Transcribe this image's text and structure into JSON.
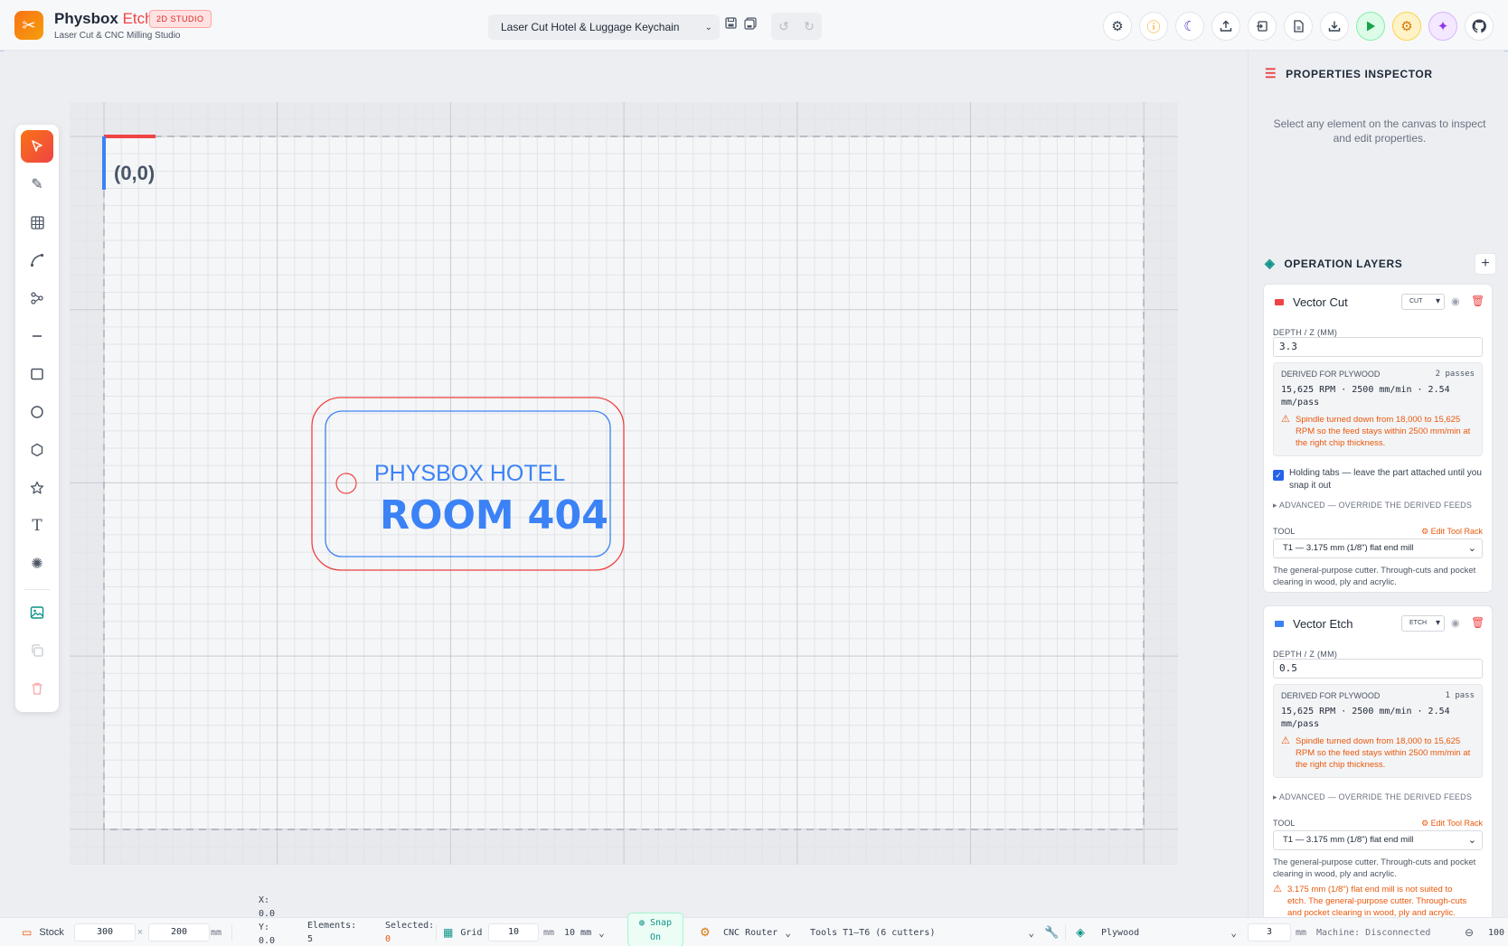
{
  "header": {
    "brand": "Physbox",
    "brand_accent": "Etch",
    "badge": "2D STUDIO",
    "subtitle": "Laser Cut & CNC Milling Studio",
    "project_name": "Laser Cut Hotel & Luggage Keychain"
  },
  "canvas": {
    "origin_label": "(0,0)",
    "keychain_line1": "PHYSBOX HOTEL",
    "keychain_line2": "ROOM 404"
  },
  "inspector": {
    "title": "PROPERTIES INSPECTOR",
    "empty_text": "Select any element on the canvas to inspect and edit properties."
  },
  "layers": {
    "title": "OPERATION LAYERS",
    "add_label": "+",
    "items": [
      {
        "name": "Vector Cut",
        "type": "CUT",
        "color": "#ef4444",
        "depth_label": "DEPTH / Z (MM)",
        "depth": "3.3",
        "derived_label": "DERIVED FOR PLYWOOD",
        "passes": "2 passes",
        "rates": "15,625 RPM · 2500 mm/min · 2.54 mm/pass",
        "warning": "Spindle turned down from 18,000 to 15,625 RPM so the feed stays within 2500 mm/min at the right chip thickness.",
        "tabs_text": "Holding tabs — leave the part attached until you snap it out",
        "advanced": "▸ ADVANCED — OVERRIDE THE DERIVED FEEDS",
        "tool_label": "TOOL",
        "edit_rack": "⚙ Edit Tool Rack",
        "tool": "T1 — 3.175 mm (1/8\") flat end mill",
        "tool_desc": "The general-purpose cutter. Through-cuts and pocket clearing in wood, ply and acrylic."
      },
      {
        "name": "Vector Etch",
        "type": "ETCH",
        "color": "#3b82f6",
        "depth_label": "DEPTH / Z (MM)",
        "depth": "0.5",
        "derived_label": "DERIVED FOR PLYWOOD",
        "passes": "1 pass",
        "rates": "15,625 RPM · 2500 mm/min · 2.54 mm/pass",
        "warning": "Spindle turned down from 18,000 to 15,625 RPM so the feed stays within 2500 mm/min at the right chip thickness.",
        "advanced": "▸ ADVANCED — OVERRIDE THE DERIVED FEEDS",
        "tool_label": "TOOL",
        "edit_rack": "⚙ Edit Tool Rack",
        "tool": "T1 — 3.175 mm (1/8\") flat end mill",
        "tool_desc": "The general-purpose cutter. Through-cuts and pocket clearing in wood, ply and acrylic.",
        "tool_warning": "3.175 mm (1/8\") flat end mill is not suited to etch. The general-purpose cutter. Through-cuts and pocket clearing in wood, ply and acrylic."
      }
    ]
  },
  "status": {
    "stock_label": "Stock",
    "stock_w": "300",
    "times": "×",
    "stock_h": "200",
    "stock_unit": "mm",
    "x_label": "X:",
    "x_val": "0.0",
    "y_label": "Y:",
    "y_val": "0.0",
    "elements_label": "Elements:",
    "elements_val": "5",
    "selected_label": "Selected:",
    "selected_val": "0",
    "grid_label": "Grid",
    "grid_val": "10",
    "grid_unit": "mm",
    "grid_select": "10 mm",
    "snap_line1": "Snap",
    "snap_line2": "On",
    "machine": "CNC Router",
    "tools": "Tools T1–T6 (6 cutters)",
    "material": "Plywood",
    "thickness": "3",
    "thickness_unit": "mm",
    "machine_status": "Machine: Disconnected",
    "zoom": "100"
  },
  "colors": {
    "accent": "#f97316",
    "cut": "#ef4444",
    "etch": "#3b82f6",
    "warning": "#ea580c"
  }
}
